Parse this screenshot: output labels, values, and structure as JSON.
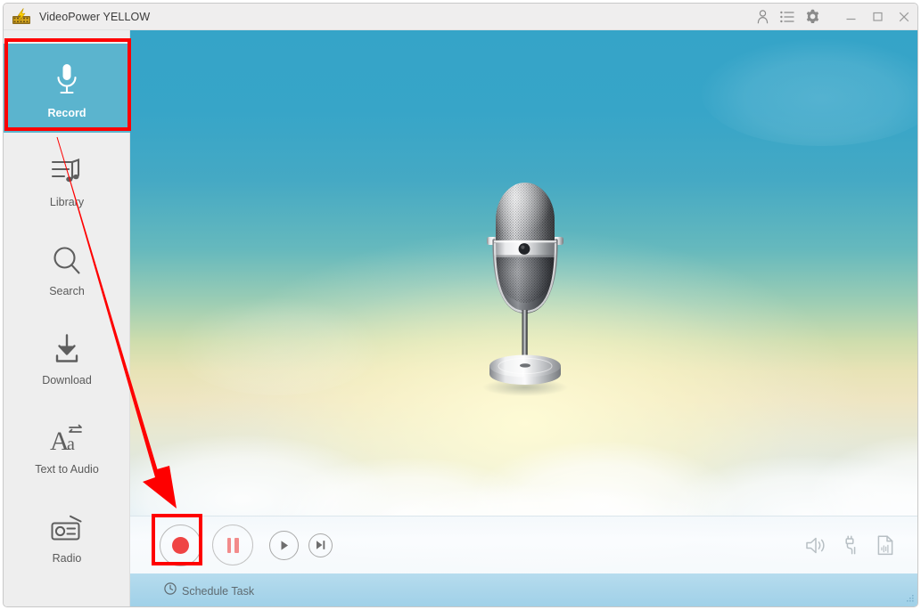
{
  "window": {
    "title": "VideoPower YELLOW",
    "app_icon": "lightning-bolt-film-icon"
  },
  "titlebar": {
    "actions": [
      {
        "name": "account-icon",
        "label": "Account"
      },
      {
        "name": "list-icon",
        "label": "Task List"
      },
      {
        "name": "gear-icon",
        "label": "Settings"
      }
    ],
    "window_controls": [
      {
        "name": "minimize-button",
        "label": "Minimize"
      },
      {
        "name": "maximize-button",
        "label": "Maximize"
      },
      {
        "name": "close-button",
        "label": "Close"
      }
    ]
  },
  "sidebar": {
    "items": [
      {
        "label": "Record",
        "icon": "microphone-icon",
        "active": true
      },
      {
        "label": "Library",
        "icon": "library-music-icon",
        "active": false
      },
      {
        "label": "Search",
        "icon": "search-icon",
        "active": false
      },
      {
        "label": "Download",
        "icon": "download-icon",
        "active": false
      },
      {
        "label": "Text to Audio",
        "icon": "text-to-audio-icon",
        "active": false
      },
      {
        "label": "Radio",
        "icon": "radio-icon",
        "active": false
      }
    ]
  },
  "stage": {
    "artwork": "vintage-microphone-illustration",
    "background": "sky-gradient-with-clouds"
  },
  "transport": {
    "buttons": [
      {
        "name": "record-button",
        "label": "Record"
      },
      {
        "name": "pause-button",
        "label": "Pause"
      },
      {
        "name": "play-button",
        "label": "Play"
      },
      {
        "name": "next-button",
        "label": "Next"
      }
    ],
    "utilities": [
      {
        "name": "speaker-icon",
        "label": "System Sound"
      },
      {
        "name": "audio-jack-icon",
        "label": "Microphone Input"
      },
      {
        "name": "audio-file-icon",
        "label": "Output File"
      }
    ]
  },
  "schedule": {
    "label": "Schedule Task",
    "icon": "clock-icon"
  },
  "annotations": {
    "record_nav_highlight": "Record",
    "record_button_highlight": "Record",
    "arrow": "red-arrow-pointing-to-record-button"
  },
  "colors": {
    "accent_teal": "#5bb4ce",
    "annotation_red": "#fe0000",
    "record_red": "#ef4444",
    "sidebar_bg": "#eeeeee",
    "titlebar_bg": "#efeeee",
    "schedule_bar": "#a9d5ea"
  }
}
